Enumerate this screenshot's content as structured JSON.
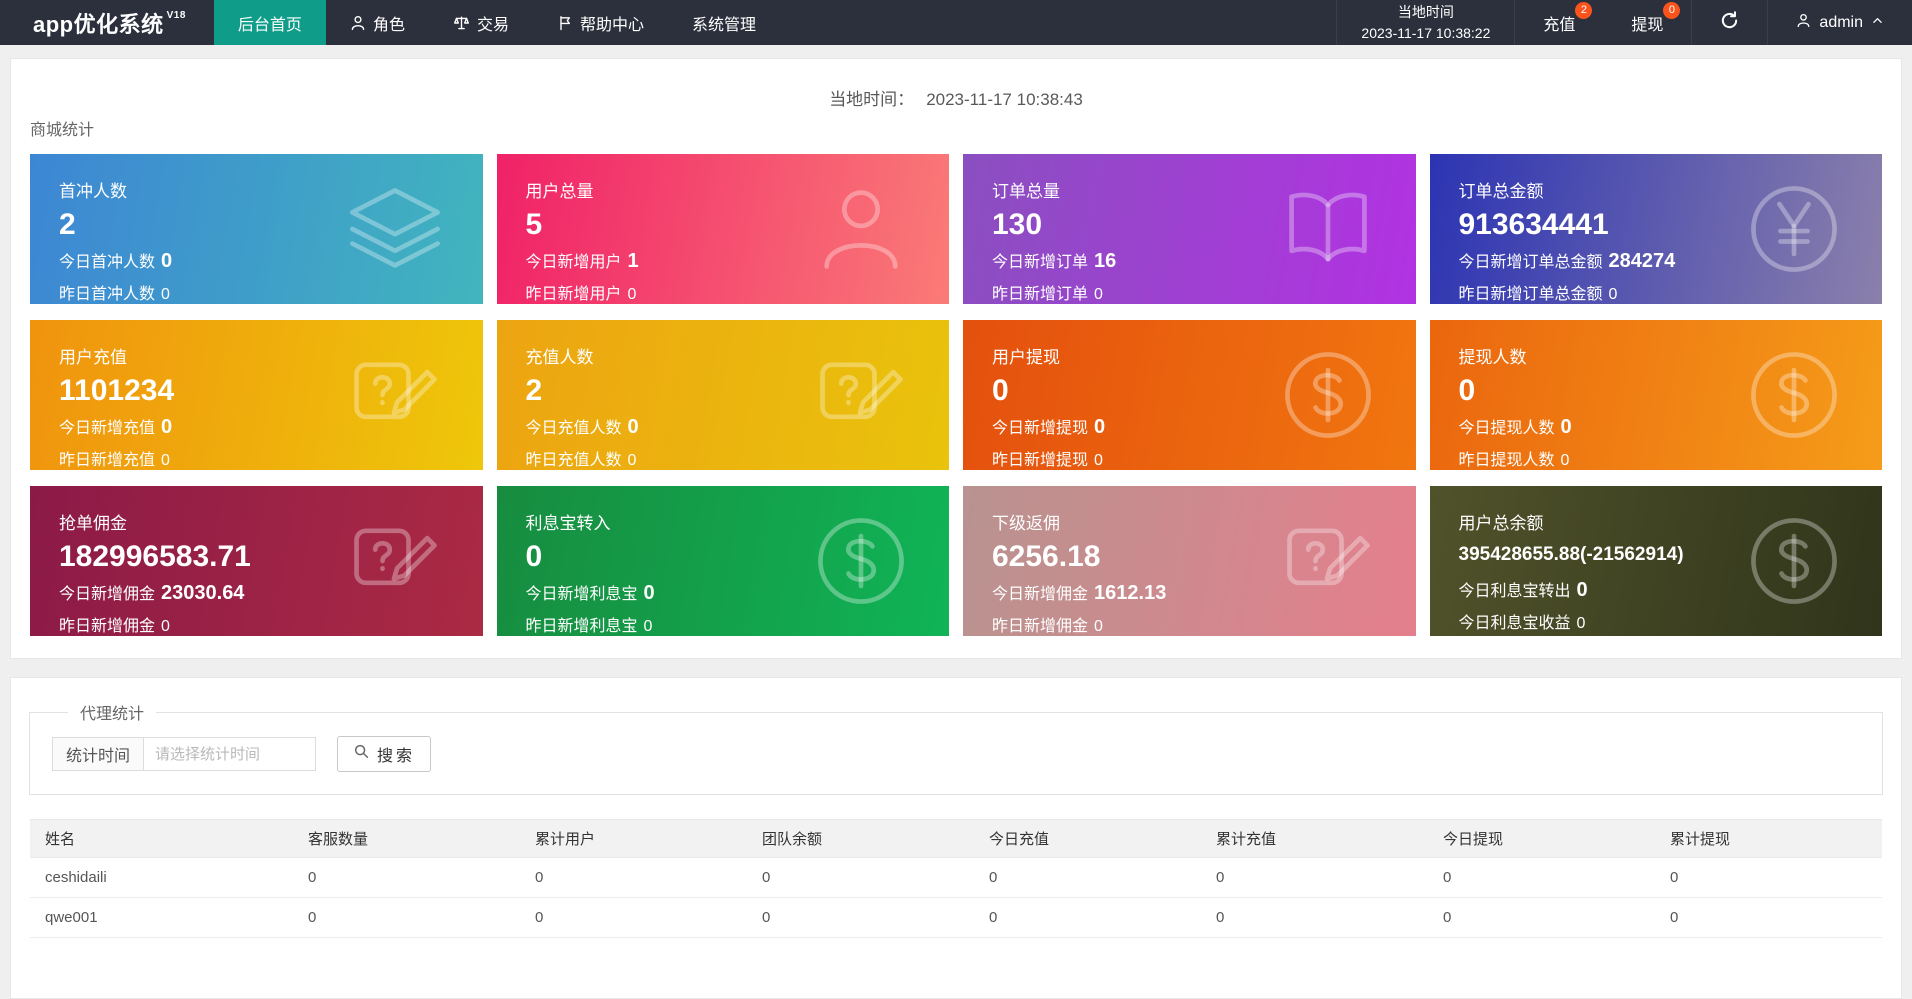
{
  "colors": {
    "navbar_bg": "#2c303c",
    "menu_active": "#0f9d8a",
    "badge": "#fa541c",
    "page_bg": "#efeff0"
  },
  "navbar": {
    "logo": "app优化系统",
    "version": "V18",
    "menu": [
      {
        "label": "后台首页",
        "icon": null,
        "active": true
      },
      {
        "label": "角色",
        "icon": "person-icon",
        "active": false
      },
      {
        "label": "交易",
        "icon": "scales-icon",
        "active": false
      },
      {
        "label": "帮助中心",
        "icon": "flag-icon",
        "active": false
      },
      {
        "label": "系统管理",
        "icon": null,
        "active": false
      }
    ],
    "time_label": "当地时间",
    "time_value": "2023-11-17 10:38:22",
    "recharge": {
      "label": "充值",
      "badge": "2"
    },
    "withdraw": {
      "label": "提现",
      "badge": "0"
    },
    "refresh_icon": "refresh-icon",
    "user": "admin"
  },
  "main": {
    "time_label": "当地时间：",
    "time_value": "2023-11-17 10:38:43",
    "section_title": "商城统计",
    "cards": [
      {
        "title": "首冲人数",
        "value": "2",
        "line2_label": "今日首冲人数",
        "line2_value": "0",
        "line3_label": "昨日首冲人数",
        "line3_value": "0",
        "icon": "layers-icon",
        "color_from": "#3d86d4",
        "color_to": "#41b5be"
      },
      {
        "title": "用户总量",
        "value": "5",
        "line2_label": "今日新增用户",
        "line2_value": "1",
        "line3_label": "昨日新增用户",
        "line3_value": "0",
        "icon": "user-icon",
        "color_from": "#f02168",
        "color_to": "#fa7b77"
      },
      {
        "title": "订单总量",
        "value": "130",
        "line2_label": "今日新增订单",
        "line2_value": "16",
        "line3_label": "昨日新增订单",
        "line3_value": "0",
        "icon": "book-icon",
        "color_from": "#8a4fc0",
        "color_to": "#b232e2"
      },
      {
        "title": "订单总金额",
        "value": "913634441",
        "line2_label": "今日新增订单总金额",
        "line2_value": "284274",
        "line3_label": "昨日新增订单总金额",
        "line3_value": "0",
        "icon": "yen-icon",
        "color_from": "#2c34b3",
        "color_to": "#8b80ab"
      },
      {
        "title": "用户充值",
        "value": "1101234",
        "line2_label": "今日新增充值",
        "line2_value": "0",
        "line3_label": "昨日新增充值",
        "line3_value": "0",
        "icon": "note-edit-icon",
        "color_from": "#f0930e",
        "color_to": "#eec70a"
      },
      {
        "title": "充值人数",
        "value": "2",
        "line2_label": "今日充值人数",
        "line2_value": "0",
        "line3_label": "昨日充值人数",
        "line3_value": "0",
        "icon": "note-edit-icon",
        "color_from": "#eda411",
        "color_to": "#e9c30c"
      },
      {
        "title": "用户提现",
        "value": "0",
        "line2_label": "今日新增提现",
        "line2_value": "0",
        "line3_label": "昨日新增提现",
        "line3_value": "0",
        "icon": "dollar-icon",
        "color_from": "#e4500e",
        "color_to": "#f1760f"
      },
      {
        "title": "提现人数",
        "value": "0",
        "line2_label": "今日提现人数",
        "line2_value": "0",
        "line3_label": "昨日提现人数",
        "line3_value": "0",
        "icon": "dollar-icon",
        "color_from": "#eb660e",
        "color_to": "#f59c19"
      },
      {
        "title": "抢单佣金",
        "value": "182996583.71",
        "line2_label": "今日新增佣金",
        "line2_value": "23030.64",
        "line3_label": "昨日新增佣金",
        "line3_value": "0",
        "icon": "note-edit-icon",
        "color_from": "#8c1a47",
        "color_to": "#ab2a44"
      },
      {
        "title": "利息宝转入",
        "value": "0",
        "line2_label": "今日新增利息宝",
        "line2_value": "0",
        "line3_label": "昨日新增利息宝",
        "line3_value": "0",
        "icon": "dollar-icon",
        "color_from": "#178c3f",
        "color_to": "#10b457"
      },
      {
        "title": "下级返佣",
        "value": "6256.18",
        "line2_label": "今日新增佣金",
        "line2_value": "1612.13",
        "line3_label": "昨日新增佣金",
        "line3_value": "0",
        "icon": "note-edit-icon",
        "color_from": "#b8938f",
        "color_to": "#e57f8d"
      },
      {
        "title": "用户总余额",
        "value": "395428655.88(-21562914)",
        "line2_label": "今日利息宝转出",
        "line2_value": "0",
        "line3_label": "今日利息宝收益",
        "line3_value": "0",
        "icon": "dollar-icon",
        "color_from": "#50522a",
        "color_to": "#30351b"
      }
    ]
  },
  "agent": {
    "legend": "代理统计",
    "filter_label": "统计时间",
    "filter_placeholder": "请选择统计时间",
    "search_label": "搜索",
    "search_icon": "magnifier-icon",
    "table": {
      "headers": [
        "姓名",
        "客服数量",
        "累计用户",
        "团队余额",
        "今日充值",
        "累计充值",
        "今日提现",
        "累计提现"
      ],
      "rows": [
        [
          "ceshidaili",
          "0",
          "0",
          "0",
          "0",
          "0",
          "0",
          "0"
        ],
        [
          "qwe001",
          "0",
          "0",
          "0",
          "0",
          "0",
          "0",
          "0"
        ]
      ]
    }
  }
}
